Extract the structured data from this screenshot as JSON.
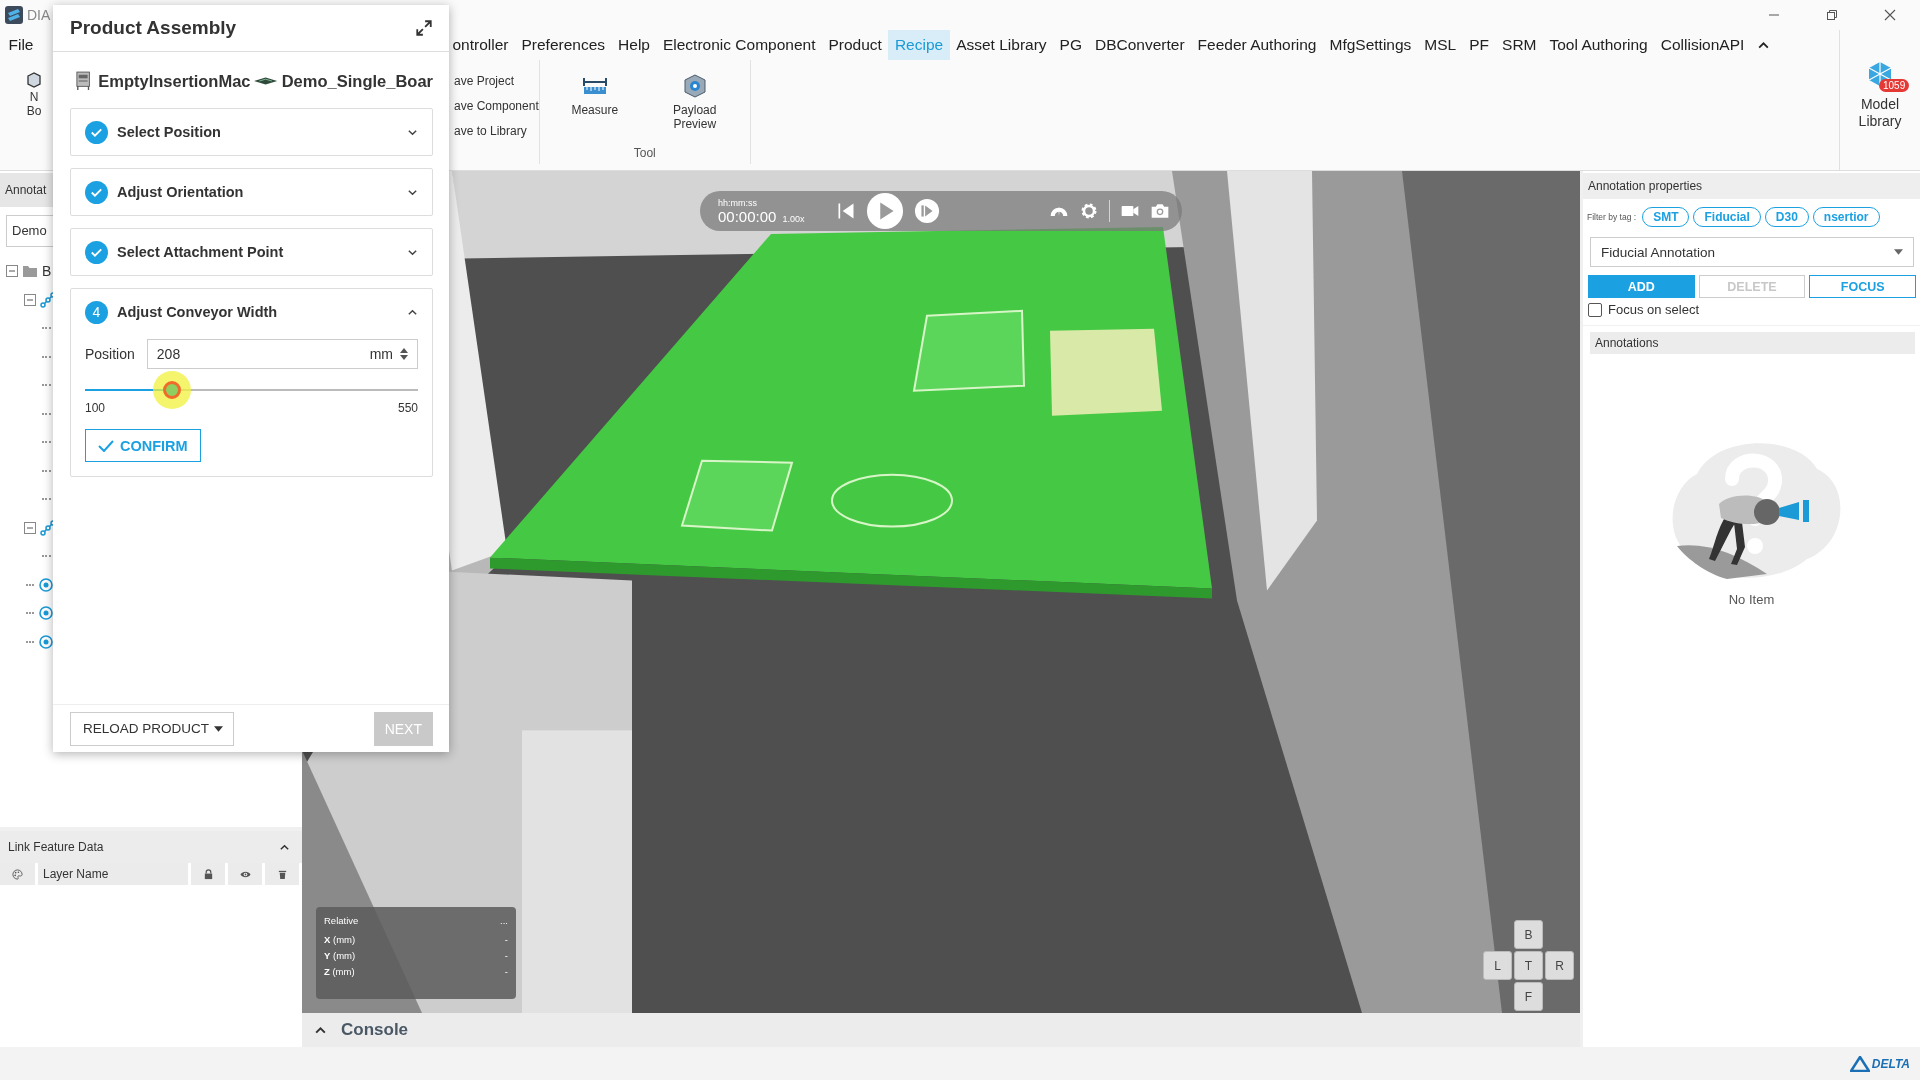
{
  "title_bar": {
    "app_name": "DIA"
  },
  "menu_bar": {
    "items": [
      {
        "label": "File",
        "selected": false
      },
      {
        "label": "ontroller",
        "selected": false
      },
      {
        "label": "Preferences",
        "selected": false
      },
      {
        "label": "Help",
        "selected": false
      },
      {
        "label": "Electronic Component",
        "selected": false
      },
      {
        "label": "Product",
        "selected": false
      },
      {
        "label": "Recipe",
        "selected": true
      },
      {
        "label": "Asset Library",
        "selected": false
      },
      {
        "label": "PG",
        "selected": false
      },
      {
        "label": "DBConverter",
        "selected": false
      },
      {
        "label": "Feeder Authoring",
        "selected": false
      },
      {
        "label": "MfgSettings",
        "selected": false
      },
      {
        "label": "MSL",
        "selected": false
      },
      {
        "label": "PF",
        "selected": false
      },
      {
        "label": "SRM",
        "selected": false
      },
      {
        "label": "Tool Authoring",
        "selected": false
      },
      {
        "label": "CollisionAPI",
        "selected": false
      }
    ]
  },
  "ribbon": {
    "left_button": {
      "lines": [
        "N",
        "Bo"
      ]
    },
    "file_actions": [
      "ave Project",
      "ave Component",
      "ave to Library"
    ],
    "tools": [
      {
        "label": "Measure",
        "kind": "measure"
      },
      {
        "label": "Payload Preview",
        "kind": "payload"
      }
    ],
    "group_label": "Tool",
    "model_library": {
      "label": "Model Library",
      "badge": "1059"
    }
  },
  "left_pane": {
    "tab": "Annotat",
    "dropdown": "Demo",
    "tree": [
      {
        "kind": "folder",
        "label": "B",
        "expanded": true,
        "children": [
          {
            "kind": "link",
            "expanded": true,
            "children": [
              {
                "kind": "leaf"
              },
              {
                "kind": "leaf"
              },
              {
                "kind": "leaf"
              },
              {
                "kind": "leaf"
              },
              {
                "kind": "leaf"
              },
              {
                "kind": "leaf"
              },
              {
                "kind": "leaf"
              }
            ]
          },
          {
            "kind": "link",
            "expanded": true,
            "children": [
              {
                "kind": "leaf"
              }
            ]
          },
          {
            "kind": "target"
          },
          {
            "kind": "target"
          },
          {
            "kind": "target"
          }
        ]
      }
    ]
  },
  "link_feature_data": {
    "title": "Link Feature Data",
    "expanded": true,
    "columns": [
      {
        "kind": "palette"
      },
      {
        "kind": "text",
        "label": "Layer Name"
      },
      {
        "kind": "lock"
      },
      {
        "kind": "eye"
      },
      {
        "kind": "trash"
      }
    ]
  },
  "dialog": {
    "title": "Product Assembly",
    "machine": "EmptyInsertionMac",
    "product": "Demo_Single_Boar",
    "steps": [
      {
        "title": "Select Position",
        "completed": true,
        "expanded": false
      },
      {
        "title": "Adjust Orientation",
        "completed": true,
        "expanded": false
      },
      {
        "title": "Select Attachment Point",
        "completed": true,
        "expanded": false
      },
      {
        "number": "4",
        "title": "Adjust Conveyor Width",
        "completed": false,
        "expanded": true
      }
    ],
    "position": {
      "label": "Position",
      "value": "208",
      "unit": "mm",
      "level": 0.24,
      "min": "100",
      "max": "550"
    },
    "confirm": "CONFIRM",
    "reload": "RELOAD PRODUCT",
    "next": {
      "label": "NEXT",
      "disabled": true
    }
  },
  "viewport": {
    "kind": "picture",
    "playback": {
      "format": "hh:mm:ss",
      "time": "00:00:00",
      "speed": "1.00x"
    },
    "relative": {
      "title": "Relative",
      "menu": "...",
      "rows": [
        {
          "axis": "**X** (mm)",
          "value": "-"
        },
        {
          "axis": "**Y** (mm)",
          "value": "-"
        },
        {
          "axis": "**Z** (mm)",
          "value": "-"
        }
      ]
    },
    "view_cube": {
      "top": "B",
      "left": "L",
      "center": "T",
      "right": "R",
      "bottom": "F"
    }
  },
  "console": {
    "label": "Console",
    "expanded": false
  },
  "right_panel": {
    "title": "Annotation properties",
    "filter_label": "Filter by tag :",
    "tags": [
      "SMT",
      "Fiducial",
      "D30",
      "nsertior"
    ],
    "annotation_type": "Fiducial Annotation",
    "actions": [
      {
        "label": "ADD",
        "kind": "primary"
      },
      {
        "label": "DELETE",
        "kind": "disabled"
      },
      {
        "label": "FOCUS",
        "kind": "outline"
      }
    ],
    "focus_on_select": {
      "label": "Focus on select",
      "checked": false
    },
    "annotations_header": "Annotations",
    "empty_text": "No Item"
  },
  "status_bar": {
    "logo": "DELTA"
  }
}
